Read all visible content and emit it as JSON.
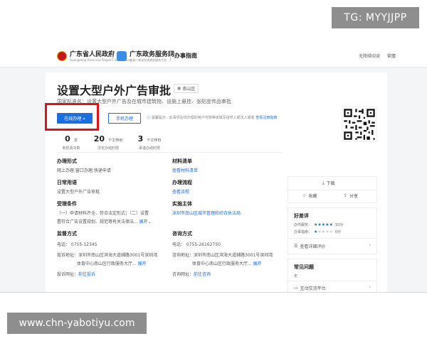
{
  "watermarks": {
    "top": "TG: MYYJJPP",
    "bottom": "www.chn-yabotiyu.com"
  },
  "header": {
    "gov_name": "广东省人民政府",
    "gov_sub": "Guangdong Provincial People's Government",
    "service_name": "广东政务服务网",
    "service_sub": "全省一体化在线政务服务平台",
    "guide": "办事指南",
    "links": [
      "无障碍阅读",
      "繁體"
    ]
  },
  "item": {
    "title": "设置大型户外广告审批",
    "location": "南山区",
    "subtitle": "国家标准名：设置大型户外广告及在城市建筑物、设施上悬挂、张贴宣传品审批",
    "btn_online": "在线办理 »",
    "btn_mobile": "手机办理",
    "tip_text": "温馨提示：此事项在线办理的用户可按等级填写自然人或法人或者",
    "tip_link": "查看注册指南"
  },
  "stats": [
    {
      "num": "0",
      "unit": "次",
      "label": "到现场次数"
    },
    {
      "num": "20",
      "unit": "个工作日",
      "label": "法定办结时限"
    },
    {
      "num": "3",
      "unit": "个工作日",
      "label": "承诺办结时限"
    }
  ],
  "info": {
    "mode_h": "办理形式",
    "mode_v": "网上办理,窗口办理,快递申请",
    "materials_h": "材料清单",
    "materials_v": "查看材料清单",
    "common_h": "日常用语",
    "common_v": "设置大型户外广告审批",
    "flow_h": "办理流程",
    "flow_v": "查看流程",
    "cond_h": "受理条件",
    "cond_v1": "（一）申请材料齐全、符合法定形式；（二）设置",
    "cond_v2": "置符合广告设置规划、规范等有关法律法...",
    "cond_more": "展开",
    "subject_h": "实施主体",
    "subject_v": "深圳市南山区城市管理和综合执法局",
    "sup_h": "监督方式",
    "sup_phone": "电话：  0755-12345",
    "sup_addr1": "投诉地址：深圳市南山区滨海大道辅路3001号深圳湾",
    "sup_addr2": "体育中心南山区行政服务大厅...",
    "sup_url_label": "投诉网址：",
    "sup_url": "前往投诉",
    "sup_more": "展开",
    "con_h": "咨询方式",
    "con_phone": "电话：  0755-26162750",
    "con_addr1": "咨询地址：深圳市南山区滨海大道辅路3001号深圳湾",
    "con_addr2": "体育中心南山区行政服务大厅...",
    "con_url_label": "咨询网址：",
    "con_url": "前往咨询",
    "con_more": "展开"
  },
  "actions": {
    "download": "下载",
    "favorite": "收藏",
    "share": "分享"
  },
  "rating": {
    "title": "好差评",
    "row1_label": "办件服务：",
    "row1_score": "10分",
    "row1_stars": 5,
    "row2_label": "办事指南：",
    "row2_score": "0分",
    "row2_stars": 1,
    "detail": "查看详细评价"
  },
  "faq": {
    "title": "常见问题",
    "none": "无",
    "forum": "互动交流平台"
  }
}
